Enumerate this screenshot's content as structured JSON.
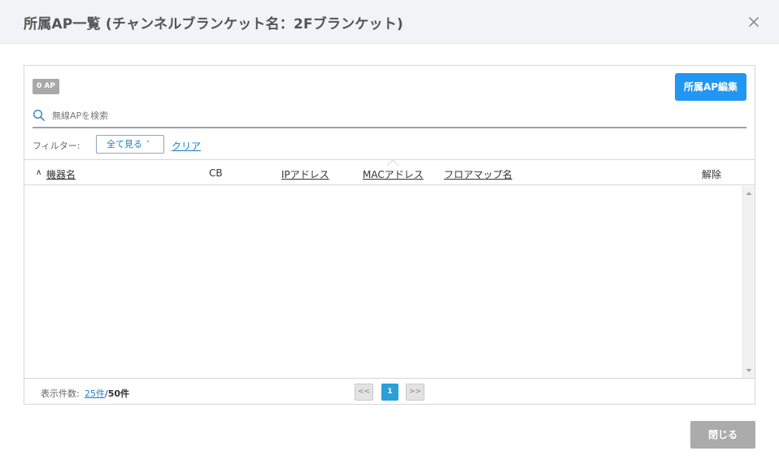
{
  "dialog": {
    "title": "所属AP一覧 (チャンネルブランケット名：2Fブランケット)",
    "close_icon": "close-icon"
  },
  "toolbar": {
    "ap_count_badge": "0 AP",
    "edit_button": "所属AP編集",
    "accent_color": "#2196f3"
  },
  "search": {
    "placeholder": "無線APを検索",
    "value": "",
    "icon": "search-icon"
  },
  "filter": {
    "label": "フィルター:",
    "selected": "全て見る",
    "chevron": "˅",
    "clear_link": "クリア"
  },
  "table": {
    "sort_indicator": "∧",
    "columns": [
      {
        "key": "device_name",
        "label": "機器名",
        "sortable": true
      },
      {
        "key": "cb",
        "label": "CB",
        "sortable": false
      },
      {
        "key": "ip",
        "label": "IPアドレス",
        "sortable": true
      },
      {
        "key": "mac",
        "label": "MACアドレス",
        "sortable": true
      },
      {
        "key": "floor_map",
        "label": "フロアマップ名",
        "sortable": true
      },
      {
        "key": "release",
        "label": "解除",
        "sortable": false
      }
    ],
    "rows": []
  },
  "footer": {
    "per_page_label": "表示件数:",
    "per_page_value": "25件",
    "separator": "/",
    "per_page_max": "50件",
    "pagination": {
      "prev": "<<",
      "current": "1",
      "next": ">>"
    }
  },
  "actions": {
    "close_button": "閉じる"
  }
}
